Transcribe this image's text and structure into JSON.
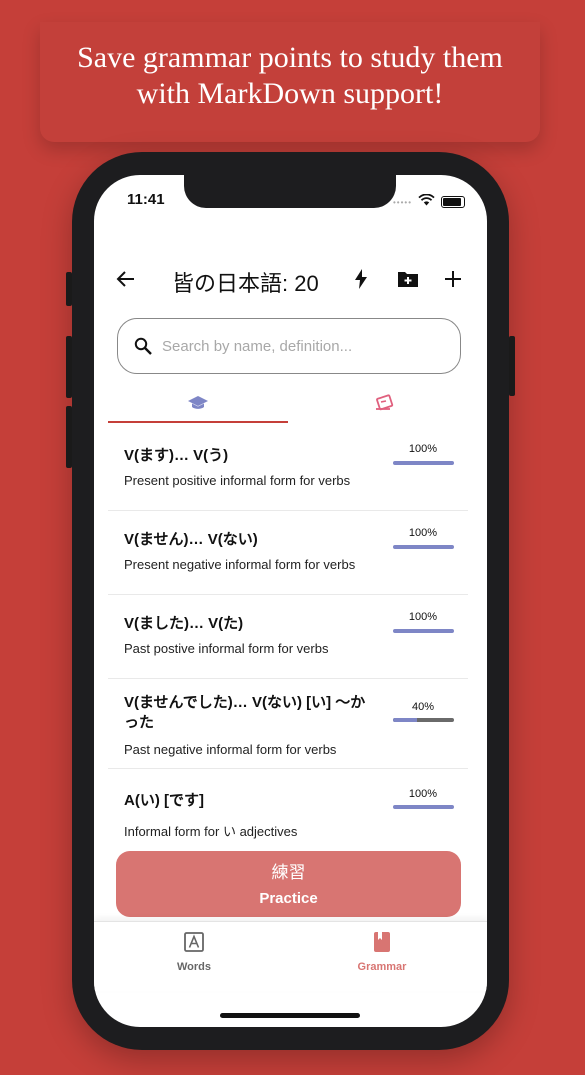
{
  "banner": {
    "line1": "Save grammar points to study them",
    "line2": "with MarkDown support!"
  },
  "status_bar": {
    "time": "11:41",
    "signal_dots": "•••••"
  },
  "header": {
    "title": "皆の日本語: 20",
    "back_icon": "arrow-left-icon",
    "actions": [
      "flash-icon",
      "folder-add-icon",
      "plus-icon"
    ]
  },
  "search": {
    "placeholder": "Search by name, definition..."
  },
  "tabs": [
    {
      "icon": "graduation-cap-icon",
      "active": true
    },
    {
      "icon": "flashcard-icon",
      "active": false
    }
  ],
  "grammar_list": [
    {
      "name": "V(ます)… V(う)",
      "description": "Present positive informal form for verbs",
      "progress_label": "100%",
      "progress": 1.0
    },
    {
      "name": "V(ません)… V(ない)",
      "description": "Present negative informal form for verbs",
      "progress_label": "100%",
      "progress": 1.0
    },
    {
      "name": "V(ました)… V(た)",
      "description": "Past postive informal form for verbs",
      "progress_label": "100%",
      "progress": 1.0
    },
    {
      "name": "V(ませんでした)… V(ない) [い] 〜かった",
      "description": "Past negative informal form for verbs",
      "progress_label": "40%",
      "progress": 0.4
    },
    {
      "name": "A(い) [です]",
      "description": "Informal form for い adjectives",
      "progress_label": "100%",
      "progress": 1.0
    }
  ],
  "practice": {
    "label_jp": "練習",
    "label_en": "Practice"
  },
  "bottom_nav": [
    {
      "label": "Words",
      "icon": "letter-a-icon",
      "active": false
    },
    {
      "label": "Grammar",
      "icon": "book-icon",
      "active": true
    }
  ],
  "colors": {
    "background": "#c53f39",
    "accent": "#c53f39",
    "progress": "#7e86c6",
    "practice_button": "#d87572",
    "tab_active_icon": "#7e86c6",
    "tab_inactive_icon": "#e0607e"
  }
}
